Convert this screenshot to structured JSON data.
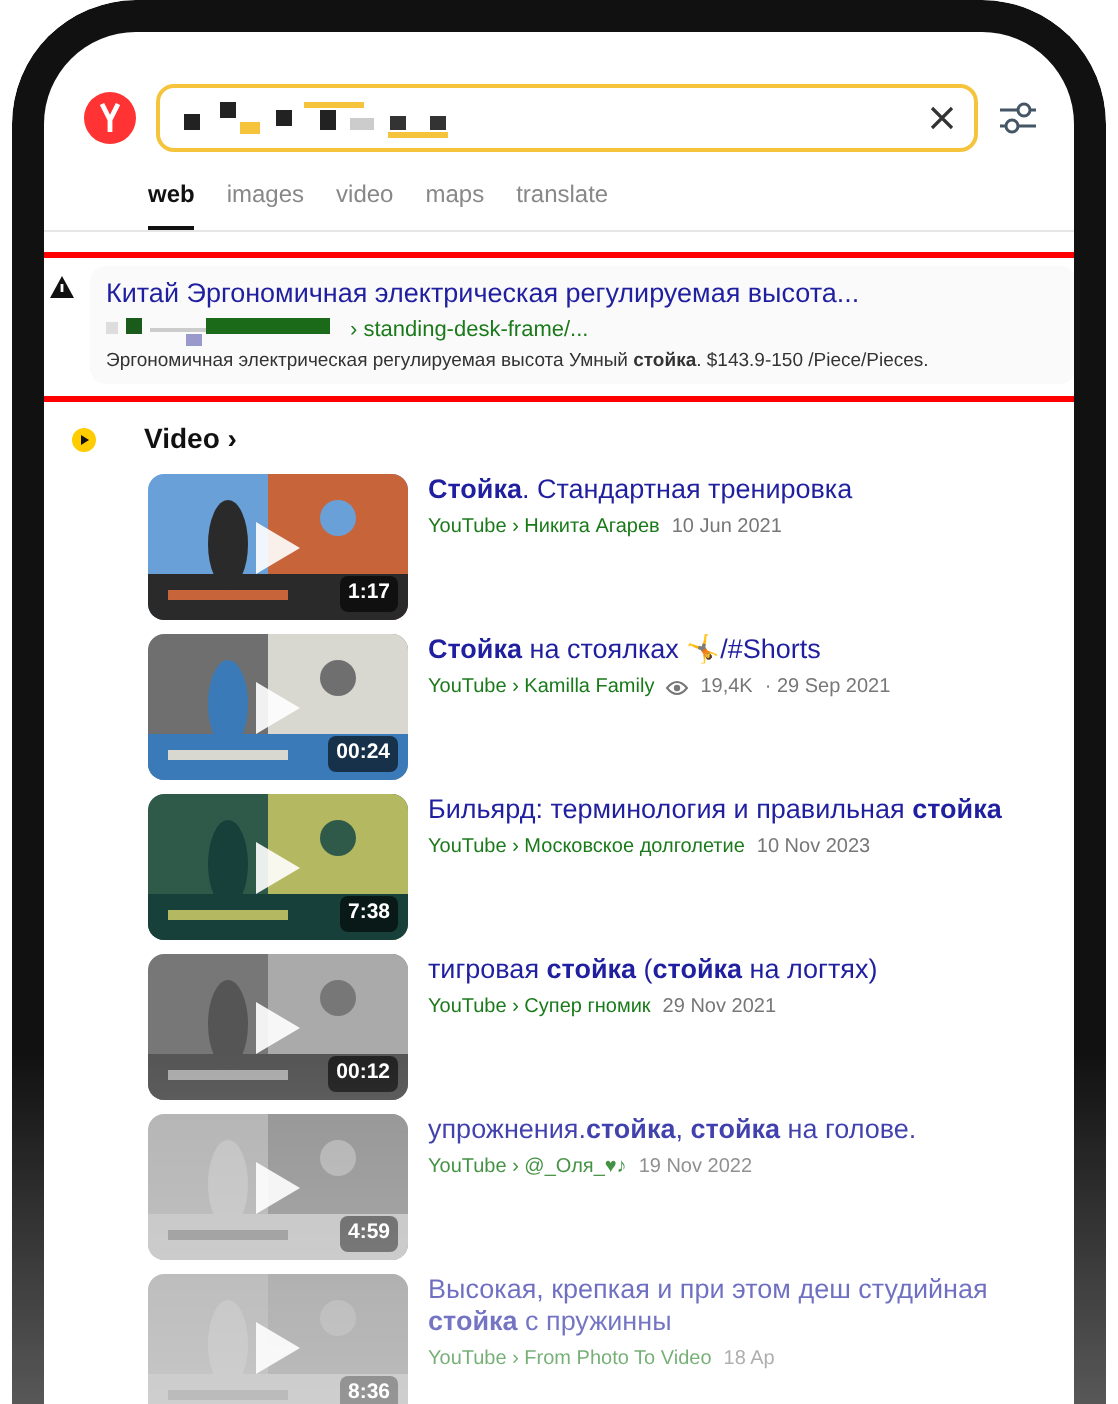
{
  "tabs": [
    {
      "label": "web",
      "selected": true
    },
    {
      "label": "images",
      "selected": false
    },
    {
      "label": "video",
      "selected": false
    },
    {
      "label": "maps",
      "selected": false
    },
    {
      "label": "translate",
      "selected": false
    }
  ],
  "result": {
    "title": "Китай Эргономичная электрическая регулируемая высота...",
    "url": "› standing-desk-frame/...",
    "snippet": "Эргономичная электрическая регулируемая высота Умный **стойка**. $143.9-150 /Piece/Pieces."
  },
  "video": {
    "heading": "Video ›",
    "items": [
      {
        "title": "**Стойка**. Стандартная тренировка",
        "source": "YouTube › Никита Агарев",
        "date": "10 Jun 2021",
        "duration": "1:17"
      },
      {
        "title": "**Стойка** на стоялках 🤸/#Shorts",
        "source": "YouTube › Kamilla Family",
        "views": "19,4K",
        "date": "· 29 Sep 2021",
        "duration": "00:24"
      },
      {
        "title": "Бильярд: терминология и правильная **стойка**",
        "source": "YouTube › Московское долголетие",
        "date": "10 Nov 2023",
        "duration": "7:38"
      },
      {
        "title": "тигровая **стойка** (**стойка** на логтях)",
        "source": "YouTube › Супер гномик",
        "date": "29 Nov 2021",
        "duration": "00:12"
      },
      {
        "title": "упрожнения.**стойка**, **стойка** на голове.",
        "source": "YouTube › @_Оля_♥♪",
        "date": "19 Nov 2022",
        "duration": "4:59"
      },
      {
        "title": "Высокая, крепкая и при этом деш студийная **стойка** с пружинны",
        "source": "YouTube › From Photo To Video",
        "date": "18 Ap",
        "duration": "8:36"
      }
    ]
  }
}
